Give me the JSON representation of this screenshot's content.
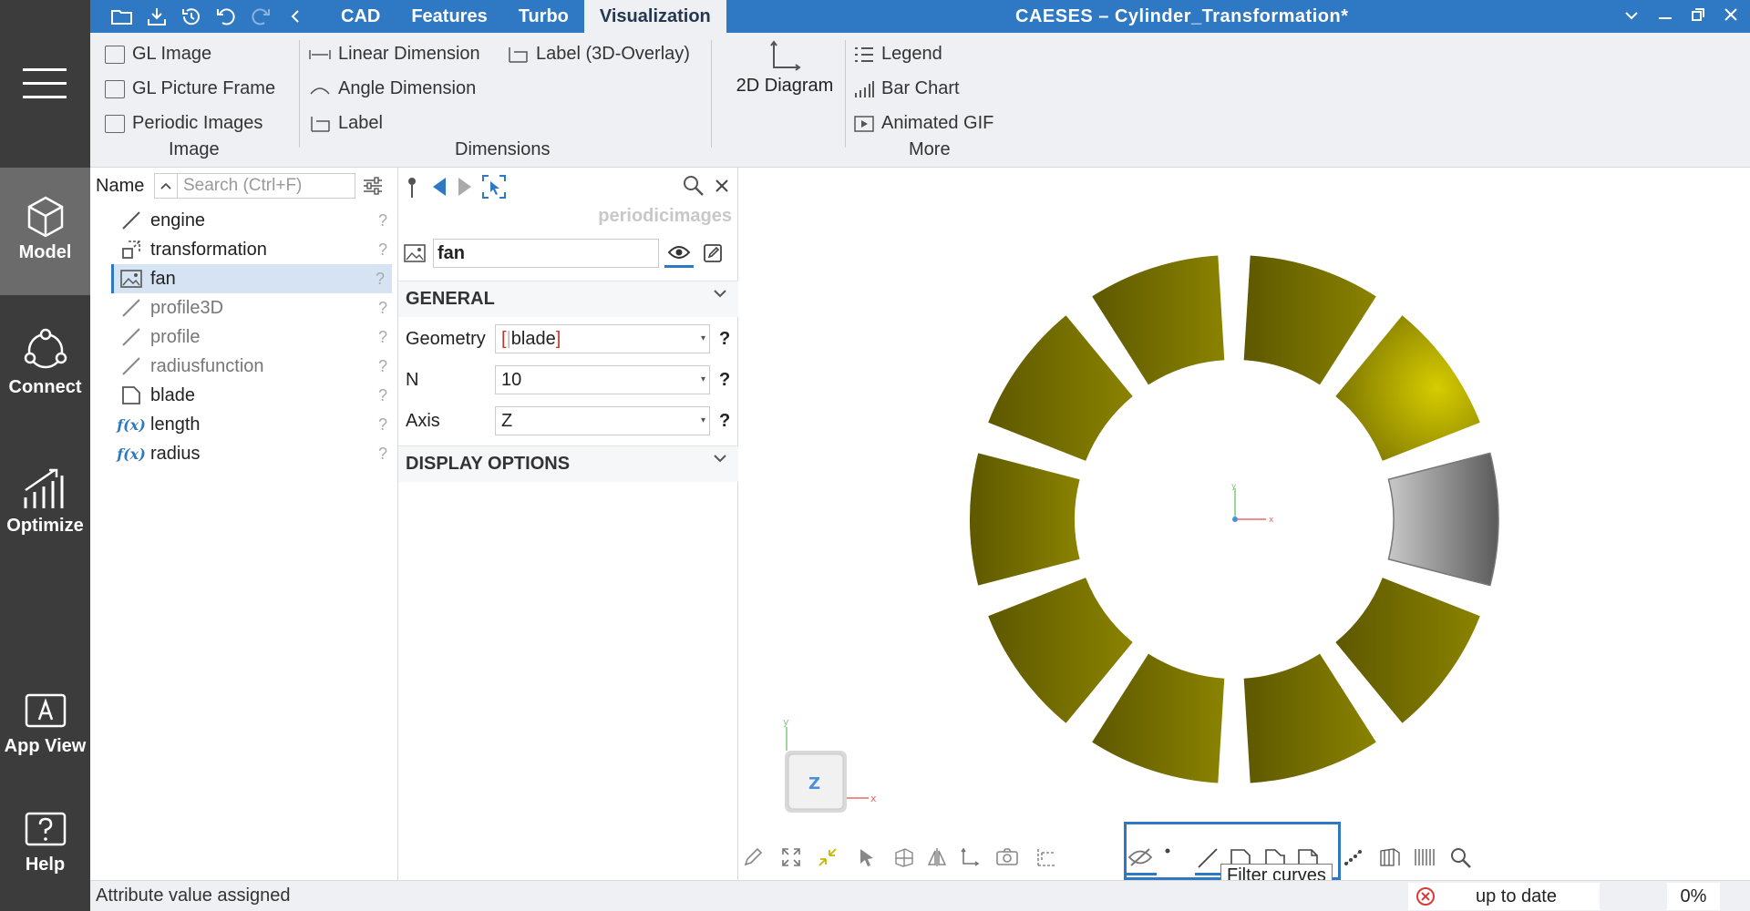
{
  "app": {
    "title": "CAESES – Cylinder_Transformation*",
    "menu_tabs": [
      {
        "label": "CAD"
      },
      {
        "label": "Features"
      },
      {
        "label": "Turbo"
      },
      {
        "label": "Visualization"
      }
    ],
    "active_tab": "Visualization"
  },
  "sidebar": {
    "items": [
      {
        "label": "Model",
        "icon": "cube-icon"
      },
      {
        "label": "Connect",
        "icon": "connect-icon"
      },
      {
        "label": "Optimize",
        "icon": "optimize-chart-icon"
      },
      {
        "label": "App View",
        "icon": "app-view-icon"
      },
      {
        "label": "Help",
        "icon": "help-icon"
      }
    ]
  },
  "ribbon": {
    "image": {
      "items": [
        "GL Image",
        "GL Picture Frame",
        "Periodic Images"
      ],
      "group_label": "Image"
    },
    "dimensions": {
      "items": [
        "Linear Dimension",
        "Angle Dimension",
        "Label",
        "Label (3D-Overlay)"
      ],
      "group_label": "Dimensions"
    },
    "diagram": {
      "label": "2D Diagram"
    },
    "more": {
      "items": [
        "Legend",
        "Bar Chart",
        "Animated GIF"
      ],
      "group_label": "More"
    }
  },
  "tree": {
    "header": "Name",
    "search_placeholder": "Search (Ctrl+F)",
    "items": [
      {
        "label": "engine",
        "icon": "curve-icon"
      },
      {
        "label": "transformation",
        "icon": "transformation-icon"
      },
      {
        "label": "fan",
        "icon": "image-icon",
        "selected": true
      },
      {
        "label": "profile3D",
        "icon": "curve-icon"
      },
      {
        "label": "profile",
        "icon": "curve-icon"
      },
      {
        "label": "radiusfunction",
        "icon": "curve-icon"
      },
      {
        "label": "blade",
        "icon": "surface-icon"
      },
      {
        "label": "length",
        "icon": "function-icon"
      },
      {
        "label": "radius",
        "icon": "function-icon"
      }
    ],
    "help_mark": "?",
    "fx_text": "f(x)"
  },
  "properties": {
    "type_label": "periodicimages",
    "object_name": "fan",
    "sections": {
      "general": "GENERAL",
      "display": "DISPLAY OPTIONS"
    },
    "fields": [
      {
        "label": "Geometry",
        "value": "blade",
        "prefix": "[",
        "divider": "|",
        "suffix": "]"
      },
      {
        "label": "N",
        "value": "10"
      },
      {
        "label": "Axis",
        "value": "Z"
      }
    ],
    "help_mark": "?"
  },
  "viewport": {
    "axis_x": "x",
    "axis_y": "y",
    "nav_cube_face": "Z",
    "tooltip": "Filter curves",
    "colors": {
      "blade": "#6b6600",
      "blade_highlight": "#d2c800",
      "selected_blade": "#9a9a9a"
    }
  },
  "status": {
    "message": "Attribute value assigned",
    "state": "up to date",
    "progress": "0%"
  }
}
